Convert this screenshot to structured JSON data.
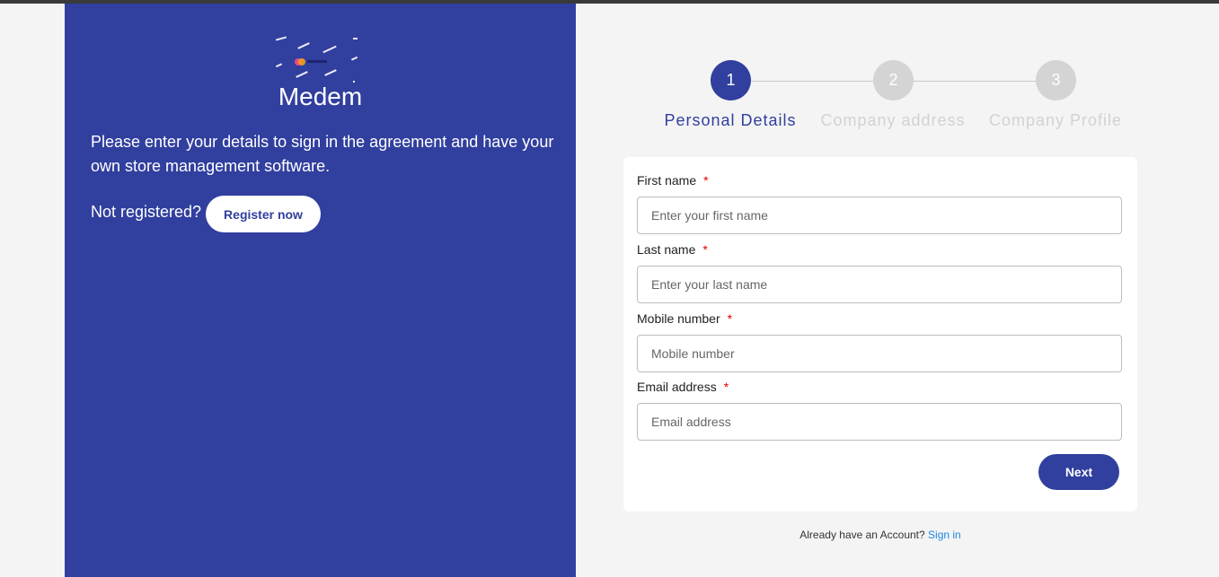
{
  "brand": {
    "name": "Medem",
    "logo_text": "Medem"
  },
  "intro": {
    "text": "Please enter your details to sign in the agreement and have your own store management software.",
    "not_registered": "Not registered?",
    "register_label": "Register now"
  },
  "stepper": {
    "steps": [
      {
        "number": "1",
        "label": "Personal Details",
        "active": true
      },
      {
        "number": "2",
        "label": "Company address",
        "active": false
      },
      {
        "number": "3",
        "label": "Company Profile",
        "active": false
      }
    ]
  },
  "form": {
    "first_name": {
      "label": "First name",
      "required_mark": "*",
      "placeholder": "Enter your first name"
    },
    "last_name": {
      "label": "Last name",
      "required_mark": "*",
      "placeholder": "Enter your last name"
    },
    "mobile": {
      "label": "Mobile number",
      "required_mark": "*",
      "placeholder": "Mobile number"
    },
    "email": {
      "label": "Email address",
      "required_mark": "*",
      "placeholder": "Email address"
    },
    "next_label": "Next"
  },
  "footer": {
    "already_text": "Already have an Account?",
    "signin_label": "Sign in"
  },
  "colors": {
    "primary": "#313f9e",
    "inactive_step": "#d4d4d4",
    "required": "#e00000",
    "link": "#1e88e5"
  }
}
